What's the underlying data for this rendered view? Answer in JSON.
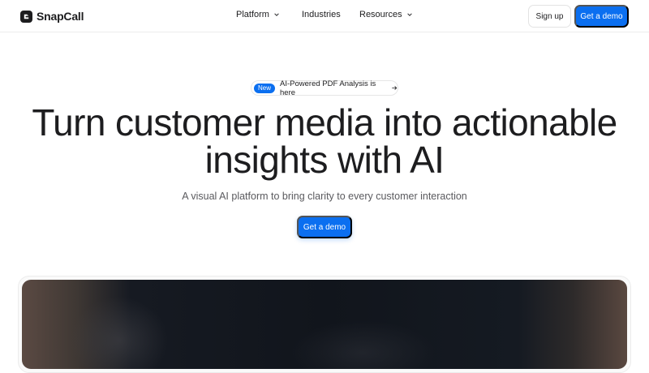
{
  "brand": {
    "name": "SnapCall",
    "logo_icon": "snapcall-logo-icon"
  },
  "nav": {
    "items": [
      {
        "label": "Platform",
        "has_dropdown": true
      },
      {
        "label": "Industries",
        "has_dropdown": false
      },
      {
        "label": "Resources",
        "has_dropdown": true
      }
    ],
    "signup_label": "Sign up",
    "demo_label": "Get a demo"
  },
  "announcement": {
    "badge": "New",
    "text": "AI-Powered PDF Analysis is here",
    "icon": "arrow-right-icon"
  },
  "hero": {
    "headline_line1": "Turn customer media into actionable",
    "headline_line2": "insights with AI",
    "subheadline": "A visual AI platform to bring clarity to every customer interaction",
    "cta_label": "Get a demo"
  },
  "colors": {
    "accent": "#0b6ff0",
    "text": "#1d1d1f",
    "muted": "#5a5a5e"
  }
}
